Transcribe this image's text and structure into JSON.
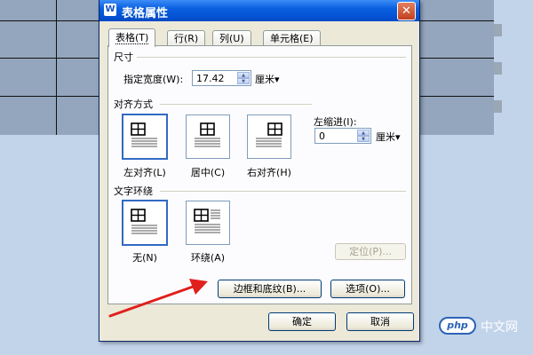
{
  "dialog": {
    "title": "表格属性",
    "app_icon_letter": "W",
    "close_glyph": "✕"
  },
  "tabs": [
    {
      "label": "表格(T)"
    },
    {
      "label": "行(R)"
    },
    {
      "label": "列(U)"
    },
    {
      "label": "单元格(E)"
    }
  ],
  "size_section": {
    "label": "尺寸",
    "width_label": "指定宽度(W):",
    "width_value": "17.42",
    "unit": "厘米▾"
  },
  "align_section": {
    "label": "对齐方式",
    "options": [
      {
        "label": "左对齐(L)"
      },
      {
        "label": "居中(C)"
      },
      {
        "label": "右对齐(H)"
      }
    ],
    "indent_label": "左缩进(I):",
    "indent_value": "0",
    "indent_unit": "厘米▾"
  },
  "wrap_section": {
    "label": "文字环绕",
    "options": [
      {
        "label": "无(N)"
      },
      {
        "label": "环绕(A)"
      }
    ],
    "position_button": "定位(P)..."
  },
  "buttons": {
    "borders": "边框和底纹(B)...",
    "options": "选项(O)...",
    "ok": "确定",
    "cancel": "取消"
  },
  "watermark": {
    "logo": "php",
    "text": "中文网"
  },
  "colors": {
    "accent": "#316ac5",
    "arrow": "#e0201c"
  }
}
